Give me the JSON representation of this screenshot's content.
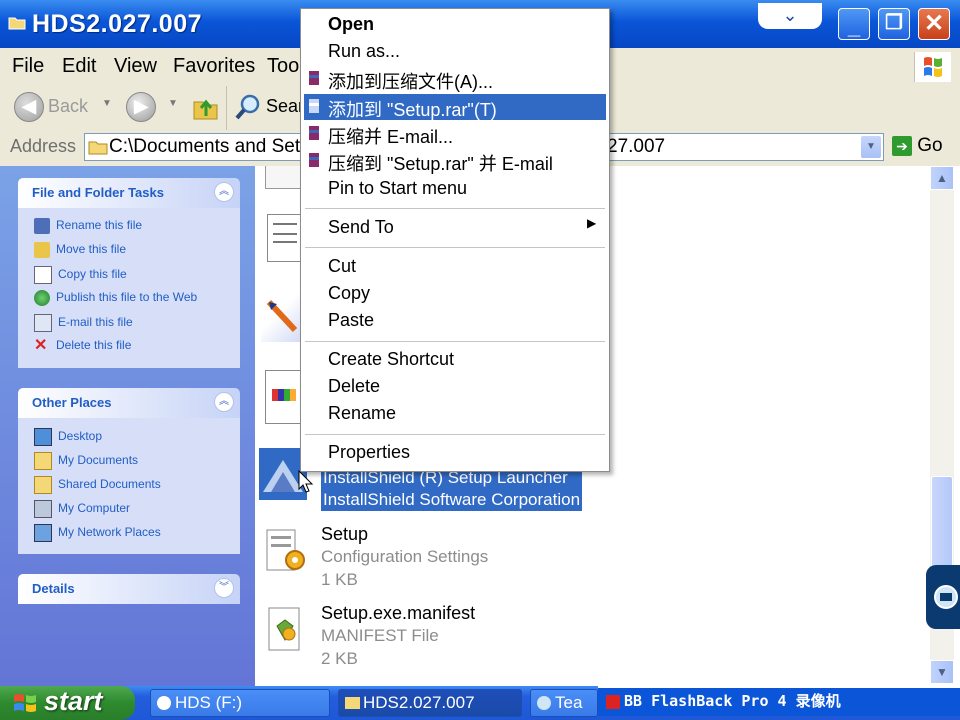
{
  "window": {
    "title": "HDS2.027.007",
    "fold_glyph": "⌄"
  },
  "menubar": [
    "File",
    "Edit",
    "View",
    "Favorites",
    "Too"
  ],
  "toolbar": {
    "back_label": "Back",
    "search_label": "Sear"
  },
  "address": {
    "label": "Address",
    "path_left": "C:\\Documents and Set",
    "path_right": "27.007",
    "go_label": "Go"
  },
  "tasks_panel": {
    "title": "File and Folder Tasks",
    "items": [
      "Rename this file",
      "Move this file",
      "Copy this file",
      "Publish this file to the Web",
      "E-mail this file",
      "Delete this file"
    ]
  },
  "places_panel": {
    "title": "Other Places",
    "items": [
      "Desktop",
      "My Documents",
      "Shared Documents",
      "My Computer",
      "My Network Places"
    ]
  },
  "details_panel": {
    "title": "Details"
  },
  "files": [
    {
      "name": "",
      "line2": "InstallShield (R) Setup Launcher",
      "line3": "InstallShield Software Corporation"
    },
    {
      "name": "Setup",
      "line2": "Configuration Settings",
      "line3": "1 KB"
    },
    {
      "name": "Setup.exe.manifest",
      "line2": "MANIFEST File",
      "line3": "2 KB"
    }
  ],
  "context_menu": {
    "items": [
      {
        "label": "Open"
      },
      {
        "label": "Run as..."
      },
      {
        "label": "添加到压缩文件(A)..."
      },
      {
        "label": "添加到 \"Setup.rar\"(T)"
      },
      {
        "label": "压缩并 E-mail..."
      },
      {
        "label": "压缩到 \"Setup.rar\" 并 E-mail"
      },
      {
        "label": "Pin to Start menu"
      },
      {
        "label": "Send To"
      },
      {
        "label": "Cut"
      },
      {
        "label": "Copy"
      },
      {
        "label": "Paste"
      },
      {
        "label": "Create Shortcut"
      },
      {
        "label": "Delete"
      },
      {
        "label": "Rename"
      },
      {
        "label": "Properties"
      }
    ],
    "highlighted": "添加到 \"Setup.rar\"(T)"
  },
  "taskbar": {
    "start_label": "start",
    "tasks": [
      "HDS (F:)",
      "HDS2.027.007",
      "Tea"
    ],
    "recorder": "BB FlashBack Pro 4 录像机"
  },
  "colors": {
    "title_blue": "#0a55d8",
    "highlight": "#316ac5",
    "task_link": "#215dc6",
    "start_green": "#2e8a2e"
  }
}
